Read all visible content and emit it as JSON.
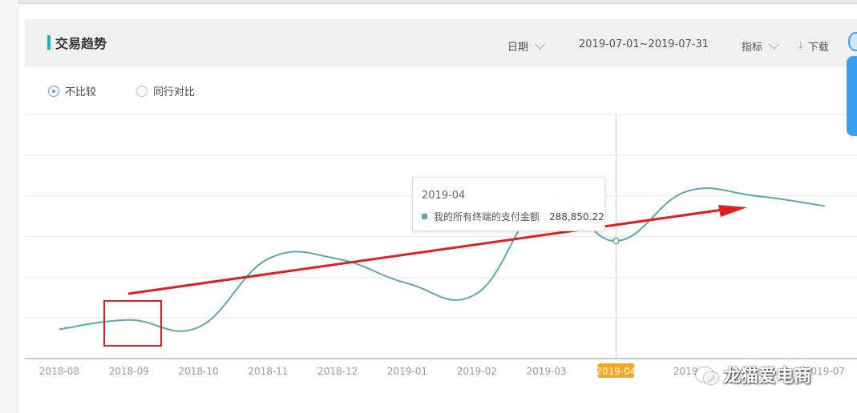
{
  "panel": {
    "title": "交易趋势",
    "date_label": "日期",
    "date_range": "2019-07-01~2019-07-31",
    "metric_label": "指标",
    "download_label": "下载"
  },
  "compare": {
    "options": [
      {
        "label": "不比较",
        "checked": true
      },
      {
        "label": "同行对比",
        "checked": false
      }
    ]
  },
  "tooltip": {
    "date": "2019-04",
    "series_label": "我的所有终端的支付金额",
    "value": "288,850.22"
  },
  "watermark": {
    "text": "龙猫爱电商"
  },
  "chart_data": {
    "type": "line",
    "categories": [
      "2018-08",
      "2018-09",
      "2018-10",
      "2018-11",
      "2018-12",
      "2019-01",
      "2019-02",
      "2019-03",
      "2019-04",
      "2019-05",
      "2019-06",
      "2019-07"
    ],
    "category_labels": [
      "2018-08",
      "2018-09",
      "2018-10",
      "2018-11",
      "2018-12",
      "2019-01",
      "2019-02",
      "2019-03",
      "2019-04",
      "2019",
      "",
      "2019-07"
    ],
    "series": [
      {
        "name": "我的所有终端的支付金额",
        "values": [
          72000,
          95000,
          77000,
          245000,
          245000,
          185000,
          160000,
          393000,
          288850.22,
          410000,
          400000,
          375000
        ]
      }
    ],
    "ylim": [
      0,
      600000
    ],
    "grid": true,
    "highlighted_category": "2019-04",
    "colors": {
      "line": "#5aa9ad",
      "highlight_tick_bg": "#f5a623",
      "grid": "#e8e8e8",
      "axis": "#bbbbbb"
    }
  },
  "colors": {
    "accent": "#1fb5c8",
    "annotation": "#e02020",
    "radio": "#5b9fd6"
  }
}
